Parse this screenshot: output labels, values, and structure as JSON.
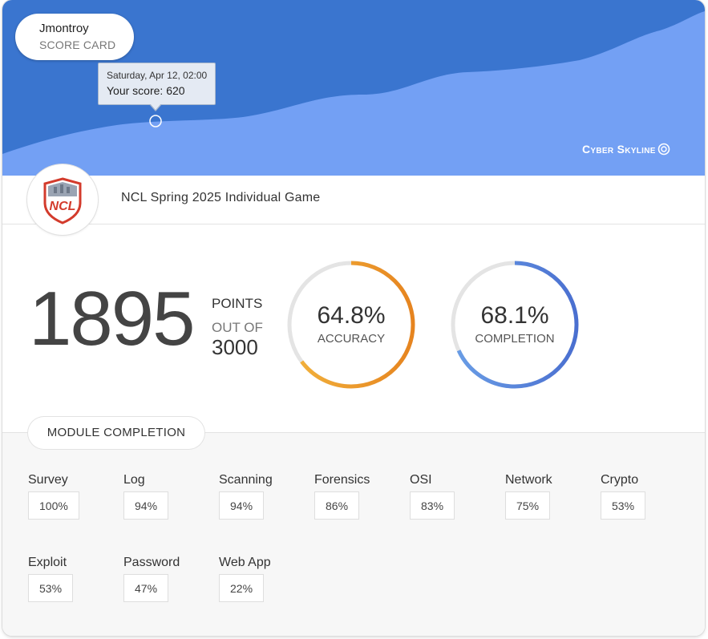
{
  "user": {
    "name": "Jmontroy",
    "subtitle": "SCORE CARD"
  },
  "tooltip": {
    "date": "Saturday, Apr 12, 02:00",
    "score_text": "Your score: 620"
  },
  "brand": {
    "name": "Cyber Skyline",
    "icon": "skyline-logo-icon"
  },
  "game": {
    "title": "NCL Spring 2025 Individual Game",
    "logo_text": "NCL",
    "logo_icon": "ncl-shield-icon"
  },
  "score": {
    "points": "1895",
    "points_label": "POINTS",
    "out_of_label": "OUT OF",
    "total": "3000"
  },
  "accuracy": {
    "value_text": "64.8%",
    "label": "ACCURACY",
    "fraction": 0.648,
    "color_start": "#f2b33d",
    "color_end": "#e6841f"
  },
  "completion": {
    "value_text": "68.1%",
    "label": "COMPLETION",
    "fraction": 0.681,
    "color_start": "#6a9ee6",
    "color_end": "#4a6fd0"
  },
  "modules": {
    "title": "MODULE COMPLETION",
    "items": [
      {
        "name": "Survey",
        "percent": "100%"
      },
      {
        "name": "Log",
        "percent": "94%"
      },
      {
        "name": "Scanning",
        "percent": "94%"
      },
      {
        "name": "Forensics",
        "percent": "86%"
      },
      {
        "name": "OSI",
        "percent": "83%"
      },
      {
        "name": "Network",
        "percent": "75%"
      },
      {
        "name": "Crypto",
        "percent": "53%"
      },
      {
        "name": "Exploit",
        "percent": "53%"
      },
      {
        "name": "Password",
        "percent": "47%"
      },
      {
        "name": "Web App",
        "percent": "22%"
      }
    ]
  },
  "colors": {
    "header_dark": "#3a75cf",
    "header_light": "#73a0f4",
    "module_bg": "#f7f7f7"
  }
}
